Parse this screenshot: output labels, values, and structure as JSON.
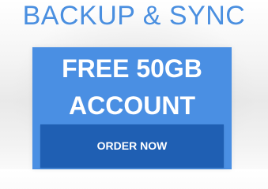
{
  "header": {
    "title": "BACKUP & SYNC"
  },
  "promo": {
    "line1": "FREE 50GB",
    "line2": "ACCOUNT",
    "cta_label": "ORDER NOW"
  },
  "colors": {
    "title": "#4a8fe0",
    "card": "#4a8fe3",
    "button": "#1f5fb3",
    "text_light": "#ffffff"
  }
}
